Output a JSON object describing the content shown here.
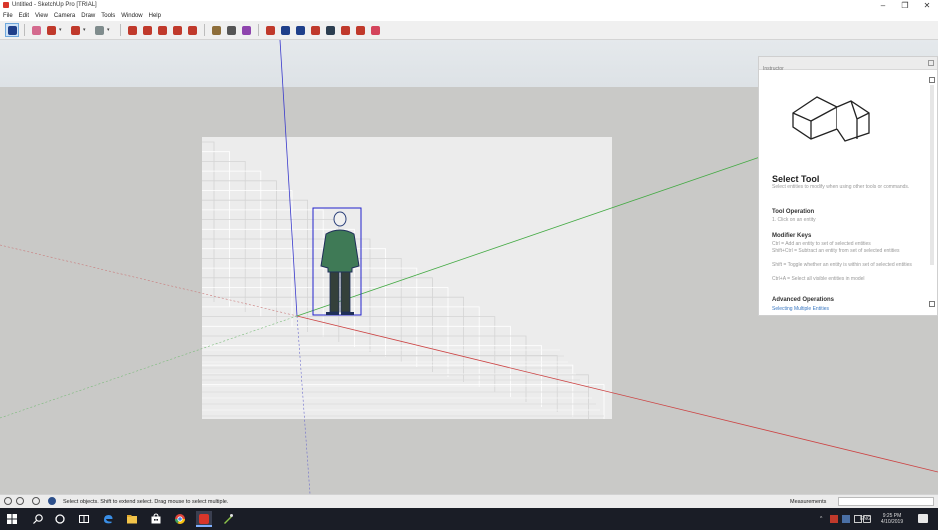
{
  "window": {
    "title": "Untitled - SketchUp Pro [TRIAL]",
    "controls": {
      "minimize": "–",
      "maximize": "❐",
      "close": "✕"
    }
  },
  "menu": [
    "File",
    "Edit",
    "View",
    "Camera",
    "Draw",
    "Tools",
    "Window",
    "Help"
  ],
  "toolbar": {
    "tools": [
      {
        "name": "select-tool",
        "color": "#1f3f8a",
        "selected": true
      },
      {
        "name": "eraser-tool",
        "color": "#d46a8e"
      },
      {
        "name": "line-tool",
        "color": "#c0392b",
        "dropdown": true
      },
      {
        "name": "arc-tool",
        "color": "#c0392b",
        "dropdown": true
      },
      {
        "name": "rectangle-tool",
        "color": "#7f8c8d",
        "dropdown": true
      },
      {
        "name": "push-pull-tool",
        "color": "#c0392b"
      },
      {
        "name": "offset-tool",
        "color": "#c0392b"
      },
      {
        "name": "move-tool",
        "color": "#c0392b"
      },
      {
        "name": "rotate-tool",
        "color": "#c0392b"
      },
      {
        "name": "scale-tool",
        "color": "#c0392b"
      },
      {
        "name": "tape-measure-tool",
        "color": "#8e6e3a"
      },
      {
        "name": "text-tool",
        "color": "#555555"
      },
      {
        "name": "paint-bucket-tool",
        "color": "#8e44ad"
      },
      {
        "name": "orbit-tool",
        "color": "#c0392b"
      },
      {
        "name": "pan-tool",
        "color": "#1f3f8a"
      },
      {
        "name": "zoom-tool",
        "color": "#1f3f8a"
      },
      {
        "name": "zoom-extents-tool",
        "color": "#c0392b"
      },
      {
        "name": "warehouse-tool",
        "color": "#2c3e50"
      },
      {
        "name": "extension-warehouse-tool",
        "color": "#c0392b"
      },
      {
        "name": "layout-tool",
        "color": "#c0392b"
      },
      {
        "name": "style-builder-tool",
        "color": "#d4445c"
      }
    ]
  },
  "instructor": {
    "panel_title": "Instructor",
    "tool_title": "Select Tool",
    "description": "Select entities to modify when using other tools or commands.",
    "sections": [
      {
        "heading": "Tool Operation",
        "lines": [
          "1.  Click on an entity"
        ]
      },
      {
        "heading": "Modifier Keys",
        "lines": [
          "Ctrl = Add an entity to set of selected entities",
          "Shift+Ctrl = Subtract an entity from set of selected entities",
          "Shift = Toggle whether an entity is within set of selected entities",
          "Ctrl+A = Select all visible entities in model"
        ]
      },
      {
        "heading": "Advanced Operations",
        "link": "Selecting Multiple Entities"
      }
    ]
  },
  "status": {
    "message": "Select objects. Shift to extend select. Drag mouse to select multiple.",
    "measurements_label": "Measurements",
    "measurements_value": ""
  },
  "taskbar": {
    "language": "ENG",
    "time": "9:25 PM",
    "date": "4/10/2019"
  }
}
